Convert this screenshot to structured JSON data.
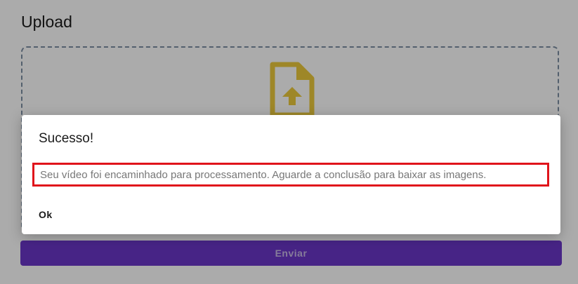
{
  "page": {
    "title": "Upload",
    "submit_label": "Enviar"
  },
  "dropzone": {
    "icon": "file-upload-icon",
    "icon_color": "#ecc93c",
    "border_color": "#7c8ea3"
  },
  "dialog": {
    "title": "Sucesso!",
    "message": "Seu vídeo foi encaminhado para processamento. Aguarde a conclusão para baixar as imagens.",
    "ok_label": "Ok",
    "highlight_color": "#e0141b"
  },
  "colors": {
    "primary": "#6a36c8",
    "overlay": "rgba(0,0,0,0.33)"
  }
}
